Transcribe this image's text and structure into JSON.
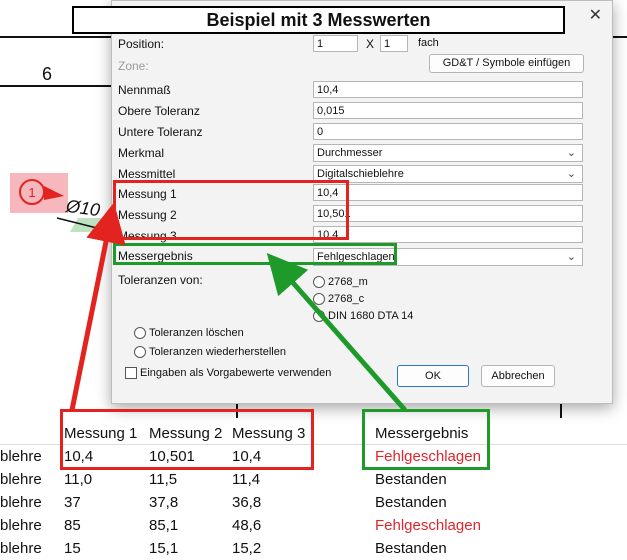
{
  "title": "Beispiel mit 3 Messwerten",
  "drawing": {
    "number": "6",
    "balloon": "1",
    "diameter": "Ø10"
  },
  "dialog": {
    "close_glyph": "✕",
    "position_label": "Position:",
    "position_value": "1",
    "x_label": "X",
    "multiplier_value": "1",
    "fach_label": "fach",
    "zone_label": "Zone:",
    "gdt_button": "GD&T / Symbole einfügen",
    "nennmass_label": "Nennmaß",
    "nennmass_value": "10,4",
    "obere_label": "Obere Toleranz",
    "obere_value": "0,015",
    "untere_label": "Untere Toleranz",
    "untere_value": "0",
    "merkmal_label": "Merkmal",
    "merkmal_value": "Durchmesser",
    "messmittel_label": "Messmittel",
    "messmittel_value": "Digitalschieblehre",
    "m1_label": "Messung 1",
    "m1_value": "10,4",
    "m2_label": "Messung 2",
    "m2_value": "10,501",
    "m3_label": "Messung 3",
    "m3_value": "10,4",
    "ergebnis_label": "Messergebnis",
    "ergebnis_value": "Fehlgeschlagen",
    "toleranzen_label": "Toleranzen von:",
    "radio_2768m": "2768_m",
    "radio_2768c": "2768_c",
    "radio_din": "DIN 1680 DTA 14",
    "radio_loeschen": "Toleranzen löschen",
    "radio_wieder": "Toleranzen wiederherstellen",
    "check_vorgabe": "Eingaben als Vorgabewerte verwenden",
    "ok": "OK",
    "cancel": "Abbrechen"
  },
  "grid": {
    "headers": [
      "Messung 1",
      "Messung 2",
      "Messung 3",
      "Messergebnis"
    ],
    "rows": [
      {
        "lead": "blehre",
        "m1": "10,4",
        "m2": "10,501",
        "m3": "10,4",
        "result": "Fehlgeschlagen",
        "failed": true
      },
      {
        "lead": "blehre",
        "m1": "11,0",
        "m2": "11,5",
        "m3": "11,4",
        "result": "Bestanden",
        "failed": false
      },
      {
        "lead": "blehre",
        "m1": "37",
        "m2": "37,8",
        "m3": "36,8",
        "result": "Bestanden",
        "failed": false
      },
      {
        "lead": "blehre",
        "m1": "85",
        "m2": "85,1",
        "m3": "48,6",
        "result": "Fehlgeschlagen",
        "failed": true
      },
      {
        "lead": "blehre",
        "m1": "15",
        "m2": "15,1",
        "m3": "15,2",
        "result": "Bestanden",
        "failed": false
      }
    ]
  },
  "colors": {
    "red": "#e3231f",
    "green": "#1e9a2a",
    "fail_text": "#e0262b"
  }
}
